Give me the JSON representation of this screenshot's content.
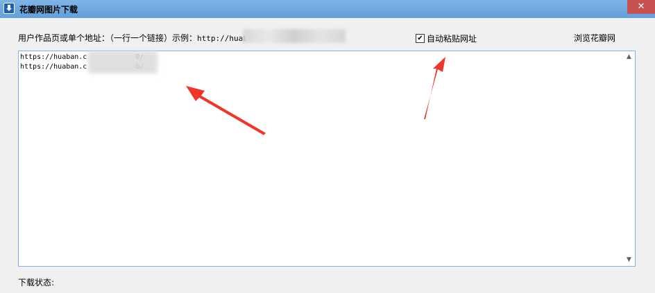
{
  "window": {
    "title": "花瓣网图片下载",
    "close_icon": "close-icon"
  },
  "form": {
    "url_label": "用户作品页或单个地址：（一行一个链接）示例：",
    "url_example": "http://huab",
    "auto_paste_label": "自动粘贴网址",
    "auto_paste_checked": true,
    "browse_label": "浏览花瓣网",
    "urls": [
      "https://huaban.c",
      "https://huaban.c"
    ],
    "url_suffixes": [
      "0/",
      "b/"
    ],
    "status_label": "下载状态:"
  },
  "colors": {
    "titlebar": "#6fa8dc",
    "close": "#c75050",
    "arrow": "#f0352a"
  }
}
